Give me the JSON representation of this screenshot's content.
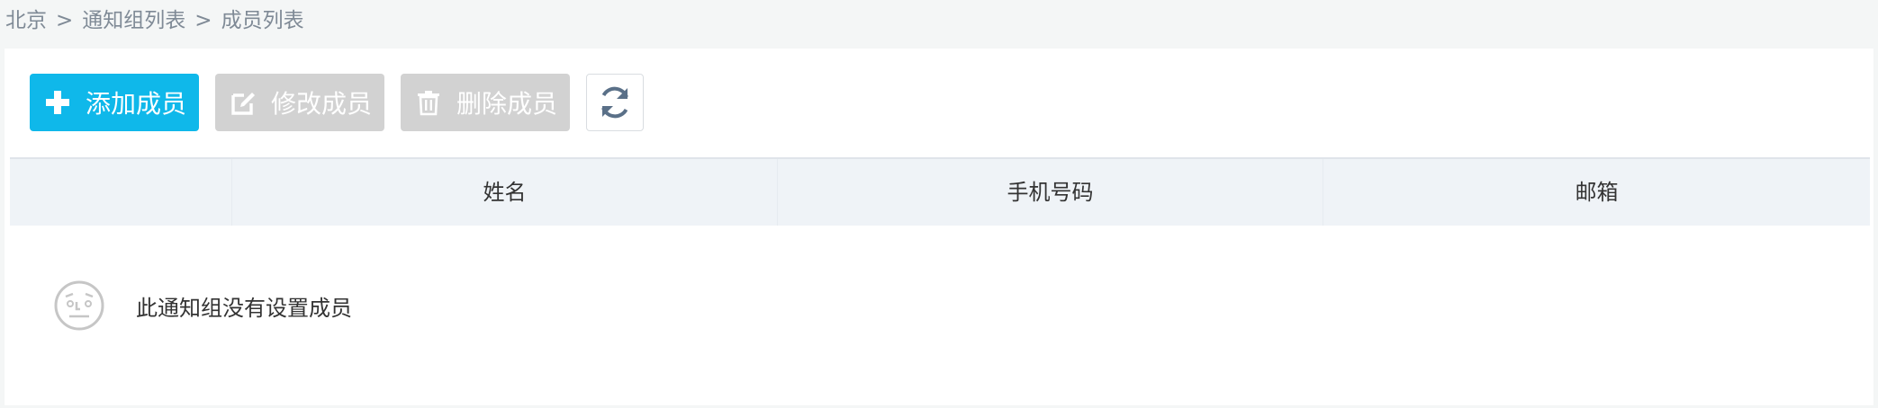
{
  "breadcrumb": {
    "items": [
      "北京",
      "通知组列表",
      "成员列表"
    ],
    "separator": ">"
  },
  "toolbar": {
    "add_label": "添加成员",
    "edit_label": "修改成员",
    "delete_label": "删除成员",
    "add_icon": "plus-icon",
    "edit_icon": "edit-icon",
    "delete_icon": "trash-icon",
    "refresh_icon": "refresh-icon",
    "add_enabled": true,
    "edit_enabled": false,
    "delete_enabled": false
  },
  "table": {
    "columns": [
      "",
      "姓名",
      "手机号码",
      "邮箱"
    ]
  },
  "empty_state": {
    "icon": "confused-face-icon",
    "message": "此通知组没有设置成员"
  },
  "colors": {
    "primary": "#0fb8ea",
    "disabled": "#d2d2d2",
    "header_bg": "#eff3f7"
  }
}
